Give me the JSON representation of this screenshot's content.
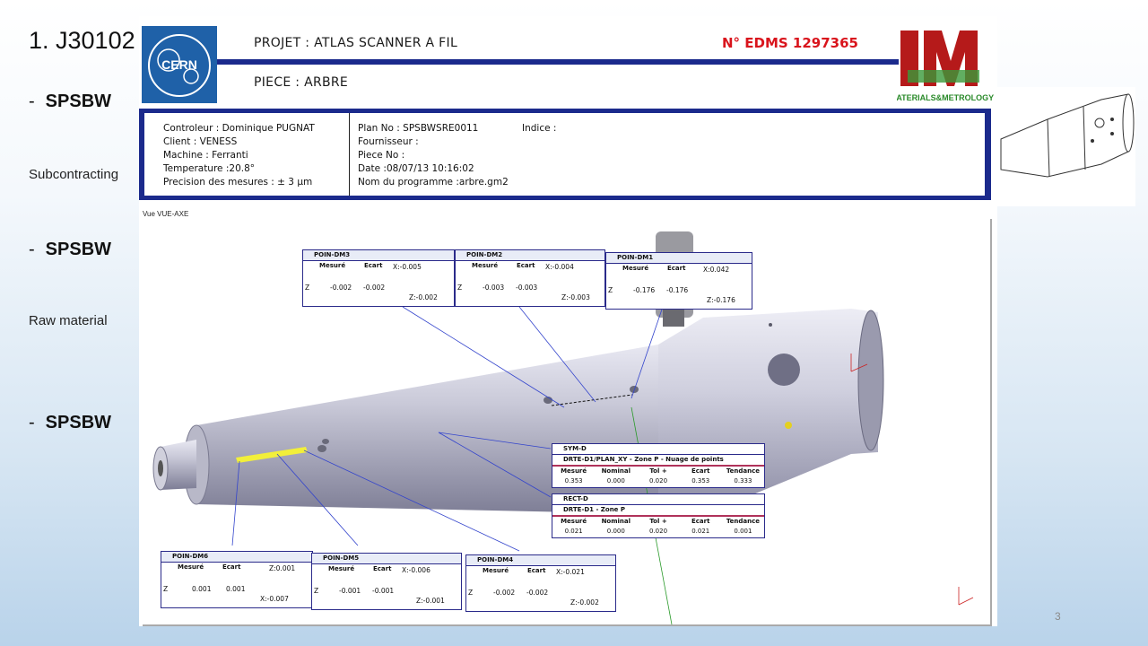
{
  "slide": {
    "title": "1. J30102",
    "bullets": [
      "SPSBW",
      "SPSBW",
      "SPSBW"
    ],
    "sub1": "Subcontracting",
    "sub2": "Raw material",
    "page_number": "3"
  },
  "report": {
    "projet_label": "PROJET :",
    "projet_value": "ATLAS SCANNER A FIL",
    "piece_label": "PIECE :",
    "piece_value": "ARBRE",
    "edms": "N° EDMS 1297365",
    "logo_text": "MATERIALS&METROLOGY",
    "info_left": [
      "Controleur : Dominique PUGNAT",
      "Client : VENESS",
      "Machine : Ferranti",
      "Temperature :20.8°",
      "Precision des mesures : ± 3 µm"
    ],
    "info_mid": [
      "Plan No : SPSBWSRE0011",
      "Fournisseur :",
      "Piece No :",
      "Date :08/07/13 10:16:02",
      "Nom du programme :arbre.gm2"
    ],
    "indice": "Indice :",
    "view_label": "Vue VUE-AXE"
  },
  "callouts": [
    {
      "name": "POIN-DM3",
      "mesure": "-0.002",
      "ecart": "-0.002",
      "x": "X:-0.005",
      "z": "Z:-0.002"
    },
    {
      "name": "POIN-DM2",
      "mesure": "-0.003",
      "ecart": "-0.003",
      "x": "X:-0.004",
      "z": "Z:-0.003"
    },
    {
      "name": "POIN-DM1",
      "mesure": "-0.176",
      "ecart": "-0.176",
      "x": "X:0.042",
      "z": "Z:-0.176"
    },
    {
      "name": "POIN-DM6",
      "mesure": "0.001",
      "ecart": "0.001",
      "x": "Z:0.001",
      "z": "X:-0.007"
    },
    {
      "name": "POIN-DM5",
      "mesure": "-0.001",
      "ecart": "-0.001",
      "x": "X:-0.006",
      "z": "Z:-0.001"
    },
    {
      "name": "POIN-DM4",
      "mesure": "-0.002",
      "ecart": "-0.002",
      "x": "X:-0.021",
      "z": "Z:-0.002"
    }
  ],
  "col_labels": {
    "mesure": "Mesuré",
    "ecart": "Ecart",
    "axis": "Z",
    "nominal": "Nominal",
    "tol": "Tol +",
    "tendance": "Tendance"
  },
  "tables": [
    {
      "name": "SYM-D",
      "desc": "DRTE-D1/PLAN_XY - Zone P - Nuage de points",
      "mesure": "0.353",
      "nominal": "0.000",
      "tol": "0.020",
      "ecart": "0.353",
      "tendance": "0.333"
    },
    {
      "name": "RECT-D",
      "desc": "DRTE-D1 - Zone P",
      "mesure": "0.021",
      "nominal": "0.000",
      "tol": "0.020",
      "ecart": "0.021",
      "tendance": "0.001"
    }
  ]
}
